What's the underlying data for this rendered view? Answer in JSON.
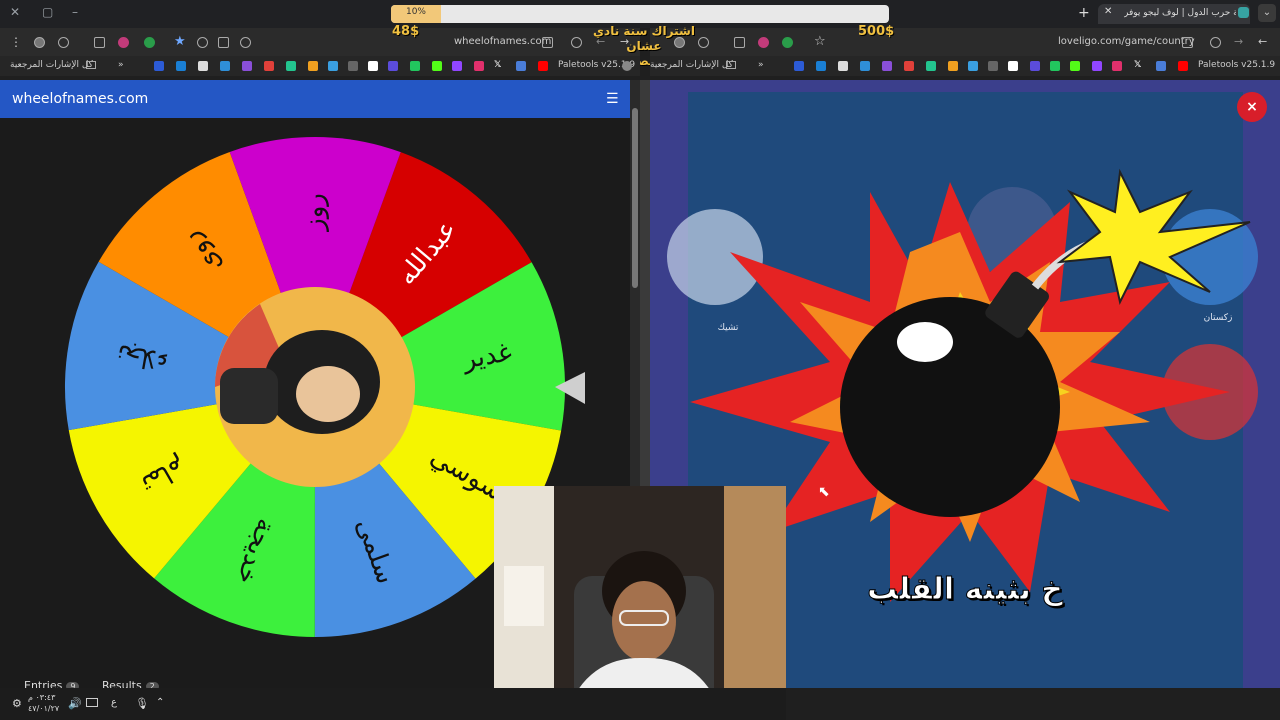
{
  "browser_left": {
    "url": "wheelofnames.com",
    "bookmarks_all": "كل الإشارات المرجعية",
    "bookmark_palette": "Paletools v25.1.9"
  },
  "browser_right": {
    "url": "loveligo.com/game/country",
    "tab_title": "لعبة حرب الدول | لوف ليجو يوفر",
    "bookmarks_all": "كل الإشارات المرجعية",
    "bookmark_palette": "Paletools v25.1.9"
  },
  "overlay": {
    "progress_label": "10%",
    "progress_value": 0.1,
    "money_left": "48$",
    "money_right": "500$",
    "subscribe_text_line1": "اشتراك سنة نادي عشان",
    "subscribe_text_line2": "اعصل"
  },
  "wheel": {
    "site_title": "wheelofnames.com",
    "menu_icon": "hamburger-icon",
    "segments": [
      {
        "label": "عبدالله",
        "color": "#d60000"
      },
      {
        "label": "غدير",
        "color": "#3df03d"
      },
      {
        "label": "سوسي",
        "color": "#f5f500"
      },
      {
        "label": "سلمى",
        "color": "#4a90e2"
      },
      {
        "label": "خديجة",
        "color": "#3df03d"
      },
      {
        "label": "تمام",
        "color": "#f5f500"
      },
      {
        "label": "نجلاء",
        "color": "#4a90e2"
      },
      {
        "label": "روى",
        "color": "#ff8c00"
      },
      {
        "label": "روز",
        "color": "#cc00cc"
      }
    ],
    "tabs": [
      {
        "label": "Entries",
        "count": "9"
      },
      {
        "label": "Results",
        "count": "2"
      }
    ]
  },
  "game": {
    "caption": "خ بثينه القلب",
    "close_label": "×"
  },
  "taskbar": {
    "time": "٠٣:٤٣ م",
    "date": "٤٧/٠١/٢٧",
    "lang": "ع"
  }
}
